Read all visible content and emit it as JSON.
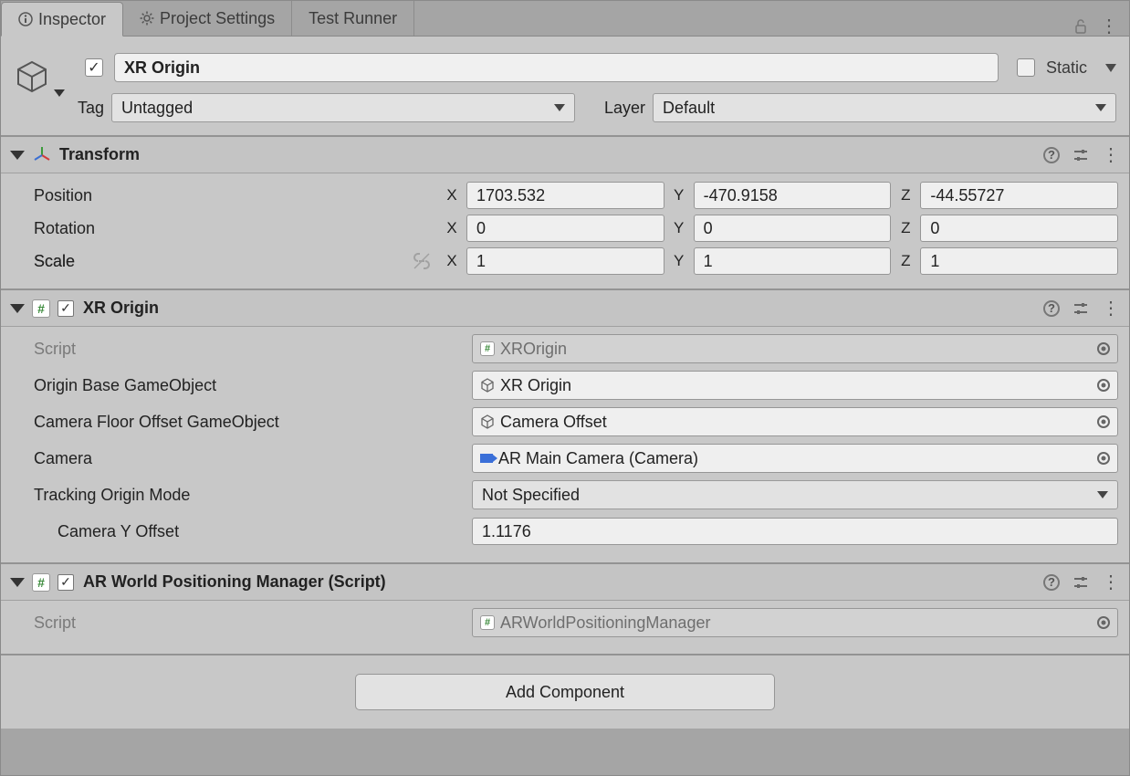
{
  "tabs": {
    "inspector": "Inspector",
    "project_settings": "Project Settings",
    "test_runner": "Test Runner"
  },
  "header": {
    "name_value": "XR Origin",
    "static_label": "Static",
    "tag_label": "Tag",
    "tag_value": "Untagged",
    "layer_label": "Layer",
    "layer_value": "Default"
  },
  "transform": {
    "title": "Transform",
    "position_label": "Position",
    "rotation_label": "Rotation",
    "scale_label": "Scale",
    "axis_x": "X",
    "axis_y": "Y",
    "axis_z": "Z",
    "position": {
      "x": "1703.532",
      "y": "-470.9158",
      "z": "-44.55727"
    },
    "rotation": {
      "x": "0",
      "y": "0",
      "z": "0"
    },
    "scale": {
      "x": "1",
      "y": "1",
      "z": "1"
    }
  },
  "xr_origin": {
    "title": "XR Origin",
    "script_label": "Script",
    "script_value": "XROrigin",
    "origin_base_label": "Origin Base GameObject",
    "origin_base_value": "XR Origin",
    "camera_floor_label": "Camera Floor Offset GameObject",
    "camera_floor_value": "Camera Offset",
    "camera_label": "Camera",
    "camera_value": "AR Main Camera (Camera)",
    "tracking_mode_label": "Tracking Origin Mode",
    "tracking_mode_value": "Not Specified",
    "camera_y_offset_label": "Camera Y Offset",
    "camera_y_offset_value": "1.1176"
  },
  "ar_world": {
    "title": "AR World Positioning Manager (Script)",
    "script_label": "Script",
    "script_value": "ARWorldPositioningManager"
  },
  "add_component_label": "Add Component"
}
